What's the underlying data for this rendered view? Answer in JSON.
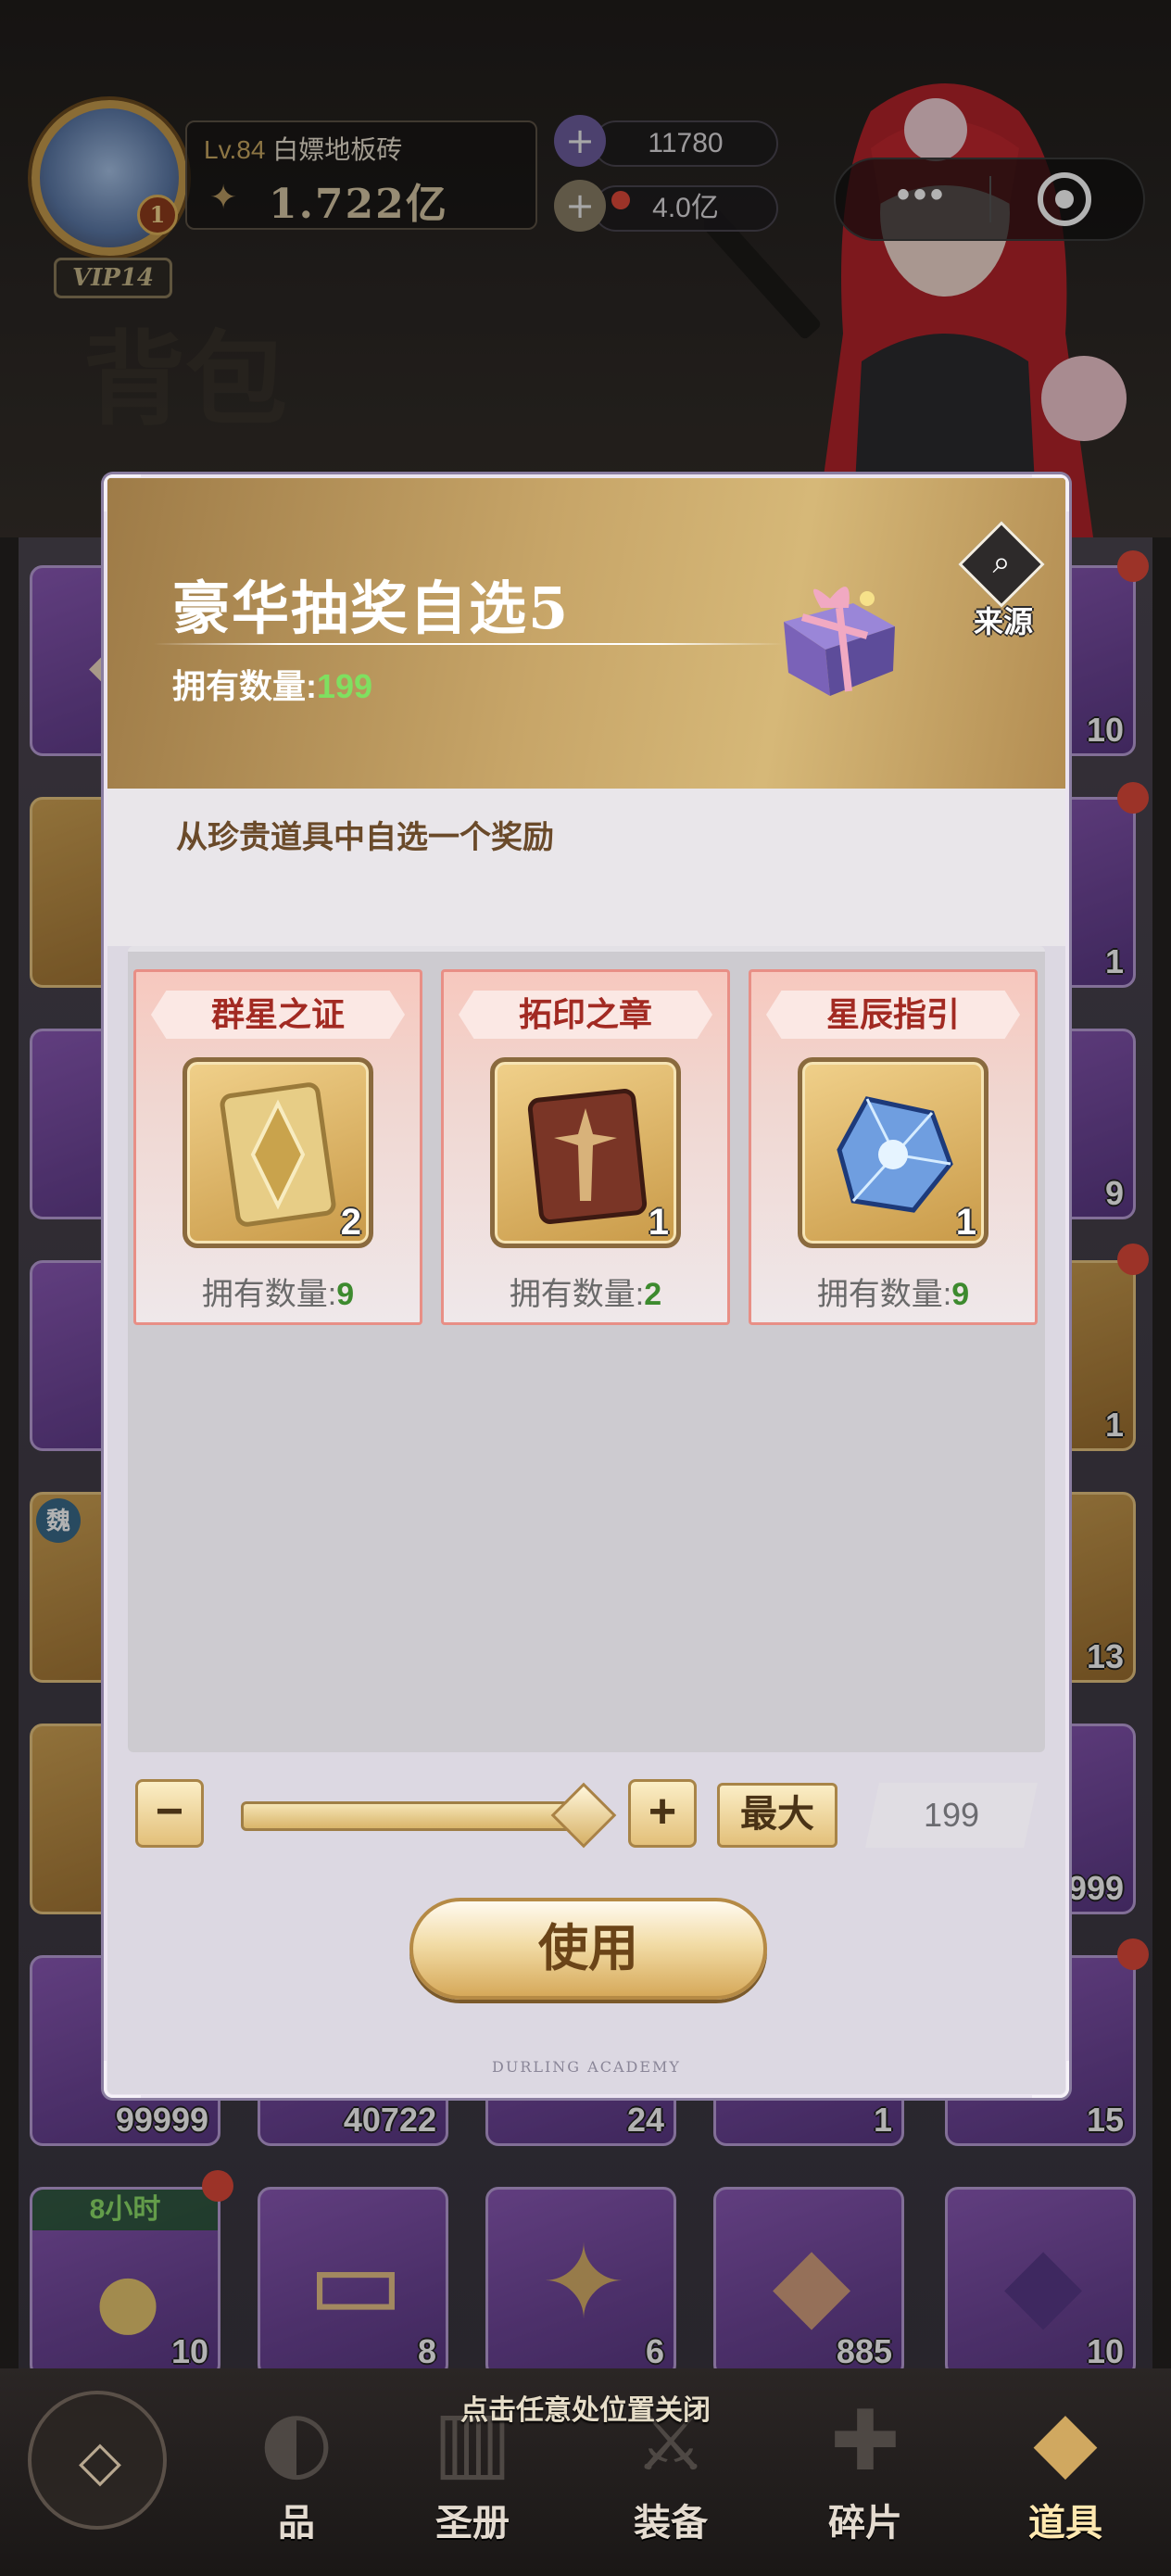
{
  "header": {
    "level_prefix": "Lv.",
    "level": "84",
    "player_name": "白嫖地板砖",
    "power": "1.722亿",
    "vip": "VIP14",
    "avatar_badge": "1",
    "currency_gem": "11780",
    "currency_coin": "4.0亿",
    "page_title": "背包",
    "more_button": "•••"
  },
  "inventory": {
    "tiles": [
      {
        "count": "10"
      },
      {
        "count": "1"
      },
      {
        "count": "9"
      },
      {
        "count": "1"
      },
      {
        "count": "13"
      },
      {
        "count": "99999"
      },
      {
        "count": "40722"
      },
      {
        "count": "24"
      },
      {
        "count": "1"
      },
      {
        "count": "15"
      },
      {
        "count": "999"
      },
      {
        "count": "10",
        "timer": "8小时"
      },
      {
        "count": "8"
      },
      {
        "count": "6"
      },
      {
        "count": "885"
      },
      {
        "count": "10"
      }
    ],
    "side_badge": "魏"
  },
  "modal": {
    "title": "豪华抽奖自选5",
    "owned_label": "拥有数量:",
    "owned_value": "199",
    "source_label": "来源",
    "description": "从珍贵道具中自选一个奖励",
    "choices": [
      {
        "name": "群星之证",
        "count": "2",
        "owned_label": "拥有数量:",
        "owned_value": "9",
        "icon": "golden-crystal-card-icon"
      },
      {
        "name": "拓印之章",
        "count": "1",
        "owned_label": "拥有数量:",
        "owned_value": "2",
        "icon": "red-book-icon"
      },
      {
        "name": "星辰指引",
        "count": "1",
        "owned_label": "拥有数量:",
        "owned_value": "9",
        "icon": "blue-crystal-icon"
      }
    ],
    "minus": "−",
    "plus": "+",
    "max_label": "最大",
    "quantity": "199",
    "slider_fraction": 1.0,
    "use_label": "使用",
    "footer_text": "DURLING ACADEMY"
  },
  "bottom_nav": {
    "hint": "点击任意处位置关闭",
    "tabs": [
      {
        "label": "品"
      },
      {
        "label": "圣册"
      },
      {
        "label": "装备"
      },
      {
        "label": "碎片"
      },
      {
        "label": "道具",
        "active": true
      }
    ]
  },
  "colors": {
    "owned_green": "#7fe060",
    "card_owned_green": "#3d8a2e",
    "header_gold": "#c7a568",
    "label_red": "#a22a22"
  }
}
